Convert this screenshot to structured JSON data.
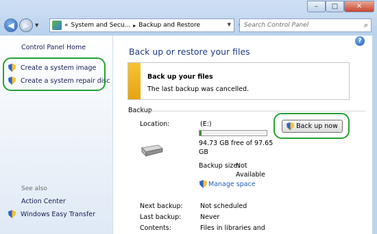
{
  "window": {
    "minimize_glyph": "–",
    "maximize_glyph": "□",
    "close_glyph": "✕"
  },
  "address": {
    "chevron": "«",
    "crumb1": "System and Secu...",
    "crumb2": "Backup and Restore",
    "separator": "▸"
  },
  "search": {
    "placeholder": "Search Control Panel"
  },
  "sidebar": {
    "home": "Control Panel Home",
    "items": [
      {
        "label": "Create a system image",
        "icon": "shield-icon"
      },
      {
        "label": "Create a system repair disc",
        "icon": "shield-icon"
      }
    ],
    "see_also_heading": "See also",
    "see_also": [
      {
        "label": "Action Center"
      },
      {
        "label": "Windows Easy Transfer",
        "icon": "shield-icon"
      }
    ]
  },
  "main": {
    "title": "Back up or restore your files",
    "notice_title": "Back up your files",
    "notice_message": "The last backup was cancelled.",
    "section": "Backup",
    "location_label": "Location:",
    "location_value": "(E:)",
    "free_space_line1": "94.73 GB free of 97.65",
    "free_space_line2": "GB",
    "disk_used_fraction": 0.03,
    "backup_size_label": "Backup size:",
    "backup_size_value1": "Not",
    "backup_size_value2": "Available",
    "manage_space": "Manage space",
    "back_up_now": "Back up now",
    "next_backup_label": "Next backup:",
    "next_backup_value": "Not scheduled",
    "last_backup_label": "Last backup:",
    "last_backup_value": "Never",
    "contents_label": "Contents:",
    "contents_value": "Files in libraries and"
  },
  "colors": {
    "highlight_green": "#27a234",
    "link_blue": "#1e5fbf",
    "title_blue": "#1e3a8a",
    "notice_bar": "#f2b622"
  }
}
